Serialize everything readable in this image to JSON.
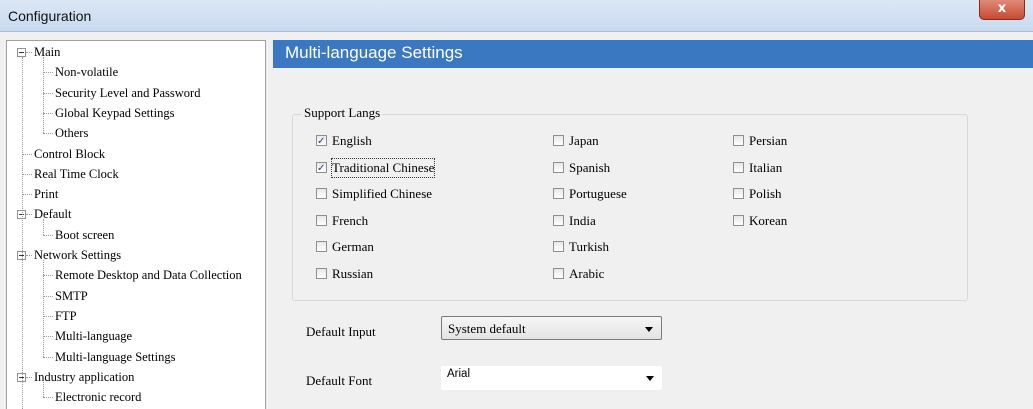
{
  "window": {
    "title": "Configuration",
    "close_glyph": "x"
  },
  "tree": {
    "items": [
      {
        "label": "Main",
        "level": 0,
        "expanded": true
      },
      {
        "label": "Non-volatile",
        "level": 1
      },
      {
        "label": "Security Level and Password",
        "level": 1
      },
      {
        "label": "Global Keypad Settings",
        "level": 1
      },
      {
        "label": "Others",
        "level": 1
      },
      {
        "label": "Control Block",
        "level": 0
      },
      {
        "label": "Real Time Clock",
        "level": 0
      },
      {
        "label": "Print",
        "level": 0
      },
      {
        "label": "Default",
        "level": 0,
        "expanded": true
      },
      {
        "label": "Boot screen",
        "level": 1
      },
      {
        "label": "Network Settings",
        "level": 0,
        "expanded": true
      },
      {
        "label": "Remote Desktop and Data Collection",
        "level": 1
      },
      {
        "label": "SMTP",
        "level": 1
      },
      {
        "label": "FTP",
        "level": 1
      },
      {
        "label": "Multi-language",
        "level": 1
      },
      {
        "label": "Multi-language Settings",
        "level": 1
      },
      {
        "label": "Industry application",
        "level": 0,
        "expanded": true
      },
      {
        "label": "Electronic record",
        "level": 1
      }
    ]
  },
  "panel": {
    "header": "Multi-language Settings",
    "support_langs": {
      "title": "Support Langs",
      "col1": [
        {
          "label": "English",
          "checked": true
        },
        {
          "label": "Traditional Chinese",
          "checked": true
        },
        {
          "label": "Simplified Chinese",
          "checked": false
        },
        {
          "label": "French",
          "checked": false
        },
        {
          "label": "German",
          "checked": false
        },
        {
          "label": "Russian",
          "checked": false
        }
      ],
      "col2": [
        {
          "label": "Japan",
          "checked": false
        },
        {
          "label": "Spanish",
          "checked": false
        },
        {
          "label": "Portuguese",
          "checked": false
        },
        {
          "label": "India",
          "checked": false
        },
        {
          "label": "Turkish",
          "checked": false
        },
        {
          "label": "Arabic",
          "checked": false
        }
      ],
      "col3": [
        {
          "label": "Persian",
          "checked": false
        },
        {
          "label": "Italian",
          "checked": false
        },
        {
          "label": "Polish",
          "checked": false
        },
        {
          "label": "Korean",
          "checked": false
        }
      ]
    },
    "default_input": {
      "label": "Default Input",
      "value": "System default"
    },
    "default_font": {
      "label": "Default Font",
      "value": "Arial"
    }
  },
  "colors": {
    "header_bg": "#3a78c2",
    "close_button": "#c74a33"
  }
}
